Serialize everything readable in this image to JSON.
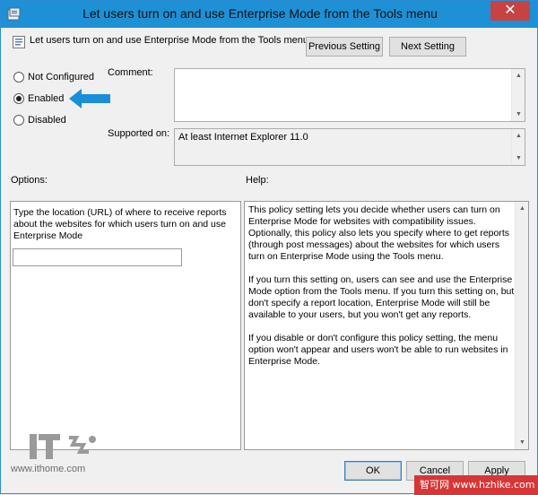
{
  "window": {
    "title": "Let users turn on and use Enterprise Mode from the Tools menu",
    "close_glyph": "✕"
  },
  "setting": {
    "name": "Let users turn on and use Enterprise Mode from the Tools menu",
    "icon": "policy-setting-icon"
  },
  "nav": {
    "previous_label": "Previous Setting",
    "next_label": "Next Setting"
  },
  "state": {
    "options": [
      {
        "label": "Not Configured",
        "checked": false
      },
      {
        "label": "Enabled",
        "checked": true
      },
      {
        "label": "Disabled",
        "checked": false
      }
    ]
  },
  "comment": {
    "label": "Comment:",
    "value": ""
  },
  "supported": {
    "label": "Supported on:",
    "value": "At least Internet Explorer 11.0"
  },
  "options_section": {
    "label": "Options:",
    "description": "Type the location (URL) of where to receive reports about the websites for which users turn on and use Enterprise Mode",
    "url_value": ""
  },
  "help": {
    "label": "Help:",
    "text": "This policy setting lets you decide whether users can turn on Enterprise Mode for websites with compatibility issues. Optionally, this policy also lets you specify where to get reports (through post messages) about the websites for which users turn on Enterprise Mode using the Tools menu.\n\nIf you turn this setting on, users can see and use the Enterprise Mode option from the Tools menu. If you turn this setting on, but don't specify a report location, Enterprise Mode will still be available to your users, but you won't get any reports.\n\nIf you disable or don't configure this policy setting, the menu option won't appear and users won't be able to run websites in Enterprise Mode."
  },
  "footer": {
    "ok_label": "OK",
    "cancel_label": "Cancel",
    "apply_label": "Apply"
  },
  "watermark": {
    "logo_text": "IT之家",
    "url": "www.ithome.com",
    "right_text": "智可网 www.hzhike.com"
  },
  "colors": {
    "titlebar": "#1e90d6",
    "arrow": "#1a8fd8",
    "close": "#c74343"
  }
}
